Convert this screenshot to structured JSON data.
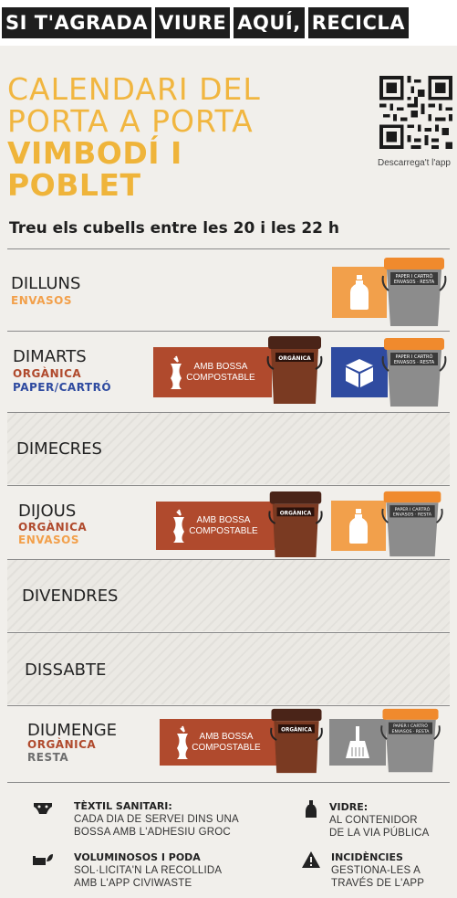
{
  "banner": [
    "SI T'AGRADA",
    "VIURE",
    "AQUÍ,",
    "RECICLA"
  ],
  "title": {
    "line1": "CALENDARI DEL",
    "line2": "PORTA A PORTA",
    "line3": "VIMBODÍ I",
    "line4": "POBLET"
  },
  "qr_caption": "Descarrega't l'app",
  "subtitle": "Treu els cubells entre les 20 i les 22 h",
  "days": {
    "dilluns": {
      "name": "DILLUNS",
      "tags": [
        "ENVASOS"
      ]
    },
    "dimarts": {
      "name": "DIMARTS",
      "tags": [
        "ORGÀNICA",
        "PAPER/CARTRÓ"
      ]
    },
    "dimecres": {
      "name": "DIMECRES"
    },
    "dijous": {
      "name": "DIJOUS",
      "tags": [
        "ORGÀNICA",
        "ENVASOS"
      ]
    },
    "divendres": {
      "name": "DIVENDRES"
    },
    "dissabte": {
      "name": "DISSABTE"
    },
    "diumenge": {
      "name": "DIUMENGE",
      "tags": [
        "ORGÀNICA",
        "RESTA"
      ]
    }
  },
  "organic_label": "AMB BOSSA COMPOSTABLE",
  "organic_bin_label": "ORGÀNICA",
  "grey_bin_label": "PAPER I CARTRÓ / ENVASOS / RESTA",
  "colors": {
    "envasos": "#f2a04b",
    "organica": "#b04a2d",
    "paper": "#2f4ba0",
    "resta": "#8a8a8a",
    "title": "#f1b640"
  },
  "footer": {
    "textil": {
      "title": "TÈXTIL SANITARI:",
      "body": [
        "CADA DIA DE SERVEI DINS UNA",
        "BOSSA AMB L'ADHESIU GROC"
      ]
    },
    "vidre": {
      "title": "VIDRE:",
      "body": [
        "AL CONTENIDOR",
        "DE LA VIA PÚBLICA"
      ]
    },
    "voluminosos": {
      "title": "VOLUMINOSOS I PODA",
      "body": [
        "SOL·LICITA'N LA RECOLLIDA",
        "AMB L'APP CIVIWASTE"
      ]
    },
    "incidencies": {
      "title": "INCIDÈNCIES",
      "body": [
        "GESTIONA-LES A",
        "TRAVÉS DE L'APP"
      ]
    }
  }
}
